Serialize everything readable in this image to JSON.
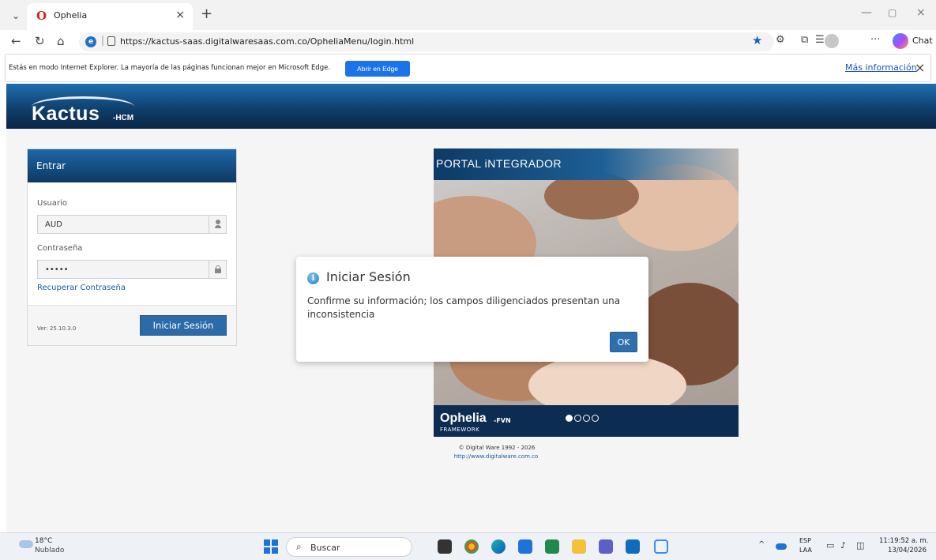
{
  "browser": {
    "tab_title": "Ophelia",
    "url": "https://kactus-saas.digitalwaresaas.com.co/OpheliaMenu/login.html",
    "chat_label": "Chat",
    "infobar_text": "Estás en modo Internet Explorer. La mayoría de las páginas funcionan mejor en Microsoft Edge.",
    "open_in_edge_label": "Abrir en Edge",
    "more_info_label": "Más información"
  },
  "header": {
    "logo_main": "Kactus",
    "logo_sub": "-HCM"
  },
  "login": {
    "panel_title": "Entrar",
    "user_label": "Usuario",
    "user_value": "AUD",
    "password_label": "Contraseña",
    "password_value": "•••••",
    "recover_link": "Recuperar Contraseña",
    "version": "Ver: 25.10.3.0",
    "submit_label": "Iniciar Sesión"
  },
  "portal": {
    "title": "PORTAL iNTEGRADOR",
    "footer_logo": "Ophelia",
    "footer_logo_sub": "-FVN",
    "footer_framework": "FRAMEWORK",
    "copyright": "© Digital Ware 1992 - 2026",
    "website": "http://www.digitalware.com.co"
  },
  "dialog": {
    "title": "Iniciar Sesión",
    "message": "Confirme su información; los campos diligenciados presentan una inconsistencia",
    "ok_label": "OK"
  },
  "taskbar": {
    "weather_temp": "18°C",
    "weather_desc": "Nublado",
    "search_placeholder": "Buscar",
    "lang_top": "ESP",
    "lang_bottom": "LAA",
    "time": "11:19:52 a. m.",
    "date": "13/04/2026"
  }
}
